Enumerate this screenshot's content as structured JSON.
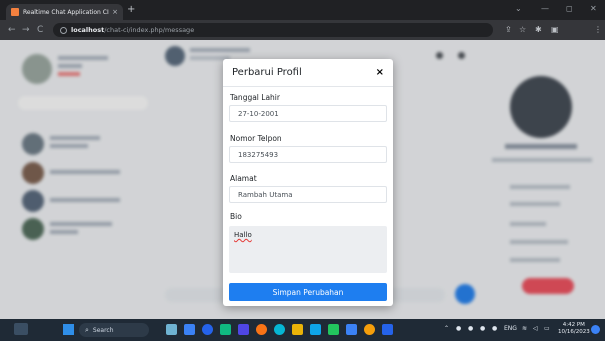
{
  "browser": {
    "tab_title": "Realtime Chat Application CI",
    "tab_close": "×",
    "new_tab": "+",
    "url_host": "localhost",
    "url_path": "/chat-ci/index.php/message",
    "controls": {
      "back": "←",
      "forward": "→",
      "reload": "C",
      "minimize": "—",
      "maximize": "◻",
      "close": "✕",
      "collapse": "⌄"
    }
  },
  "modal": {
    "title": "Perbarui Profil",
    "close": "×",
    "fields": {
      "birth_label": "Tanggal Lahir",
      "birth_value": "27-10-2001",
      "phone_label": "Nomor Telpon",
      "phone_value": "183275493",
      "address_label": "Alamat",
      "address_value": "Rambah Utama",
      "bio_label": "Bio",
      "bio_value": "Hallo"
    },
    "save_label": "Simpan Perubahan"
  },
  "taskbar": {
    "search_label": "Search",
    "tray_lang": "ENG",
    "time": "4:42 PM",
    "date": "10/16/2023"
  },
  "colors": {
    "accent": "#1e7ef0",
    "tab_favicon": "#f4813f",
    "logout_button": "#ef4b5a"
  }
}
